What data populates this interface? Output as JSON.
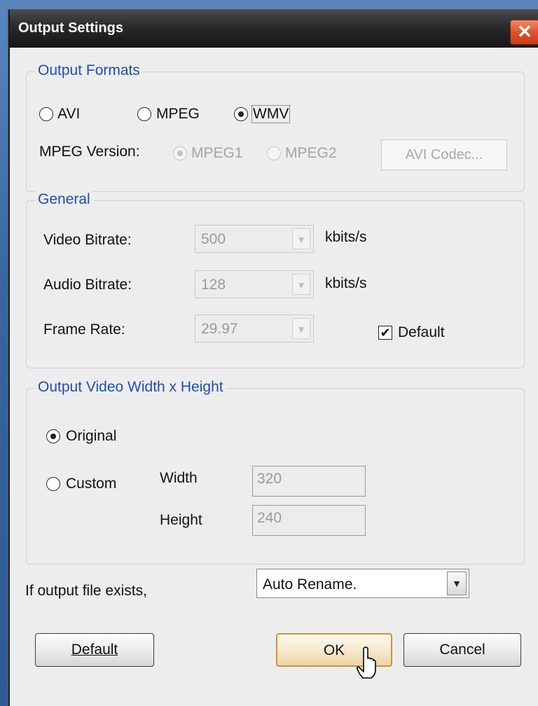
{
  "window": {
    "title": "Output Settings",
    "close_glyph": "✕"
  },
  "output_formats": {
    "legend": "Output Formats",
    "options": [
      {
        "label": "AVI",
        "selected": false
      },
      {
        "label": "MPEG",
        "selected": false
      },
      {
        "label": "WMV",
        "selected": true
      }
    ],
    "mpeg_version_label": "MPEG Version:",
    "mpeg_options": [
      {
        "label": "MPEG1",
        "selected": true,
        "enabled": false
      },
      {
        "label": "MPEG2",
        "selected": false,
        "enabled": false
      }
    ],
    "avi_codec_button": "AVI Codec..."
  },
  "general": {
    "legend": "General",
    "video_bitrate_label": "Video Bitrate:",
    "video_bitrate_value": "500",
    "audio_bitrate_label": "Audio Bitrate:",
    "audio_bitrate_value": "128",
    "frame_rate_label": "Frame Rate:",
    "frame_rate_value": "29.97",
    "unit_kbits": "kbits/s",
    "default_checkbox_label": "Default",
    "default_checked": true,
    "check_glyph": "✔"
  },
  "dimensions": {
    "legend": "Output Video Width x Height",
    "original_label": "Original",
    "custom_label": "Custom",
    "width_label": "Width",
    "width_value": "320",
    "height_label": "Height",
    "height_value": "240"
  },
  "file_exists": {
    "label": "If output file exists,",
    "selected": "Auto Rename."
  },
  "buttons": {
    "default_label": "Default",
    "ok_label": "OK",
    "cancel_label": "Cancel"
  },
  "colors": {
    "legend_blue": "#1f4fb0",
    "titlebar": "#1e1e1e",
    "close_red": "#e1512c"
  }
}
